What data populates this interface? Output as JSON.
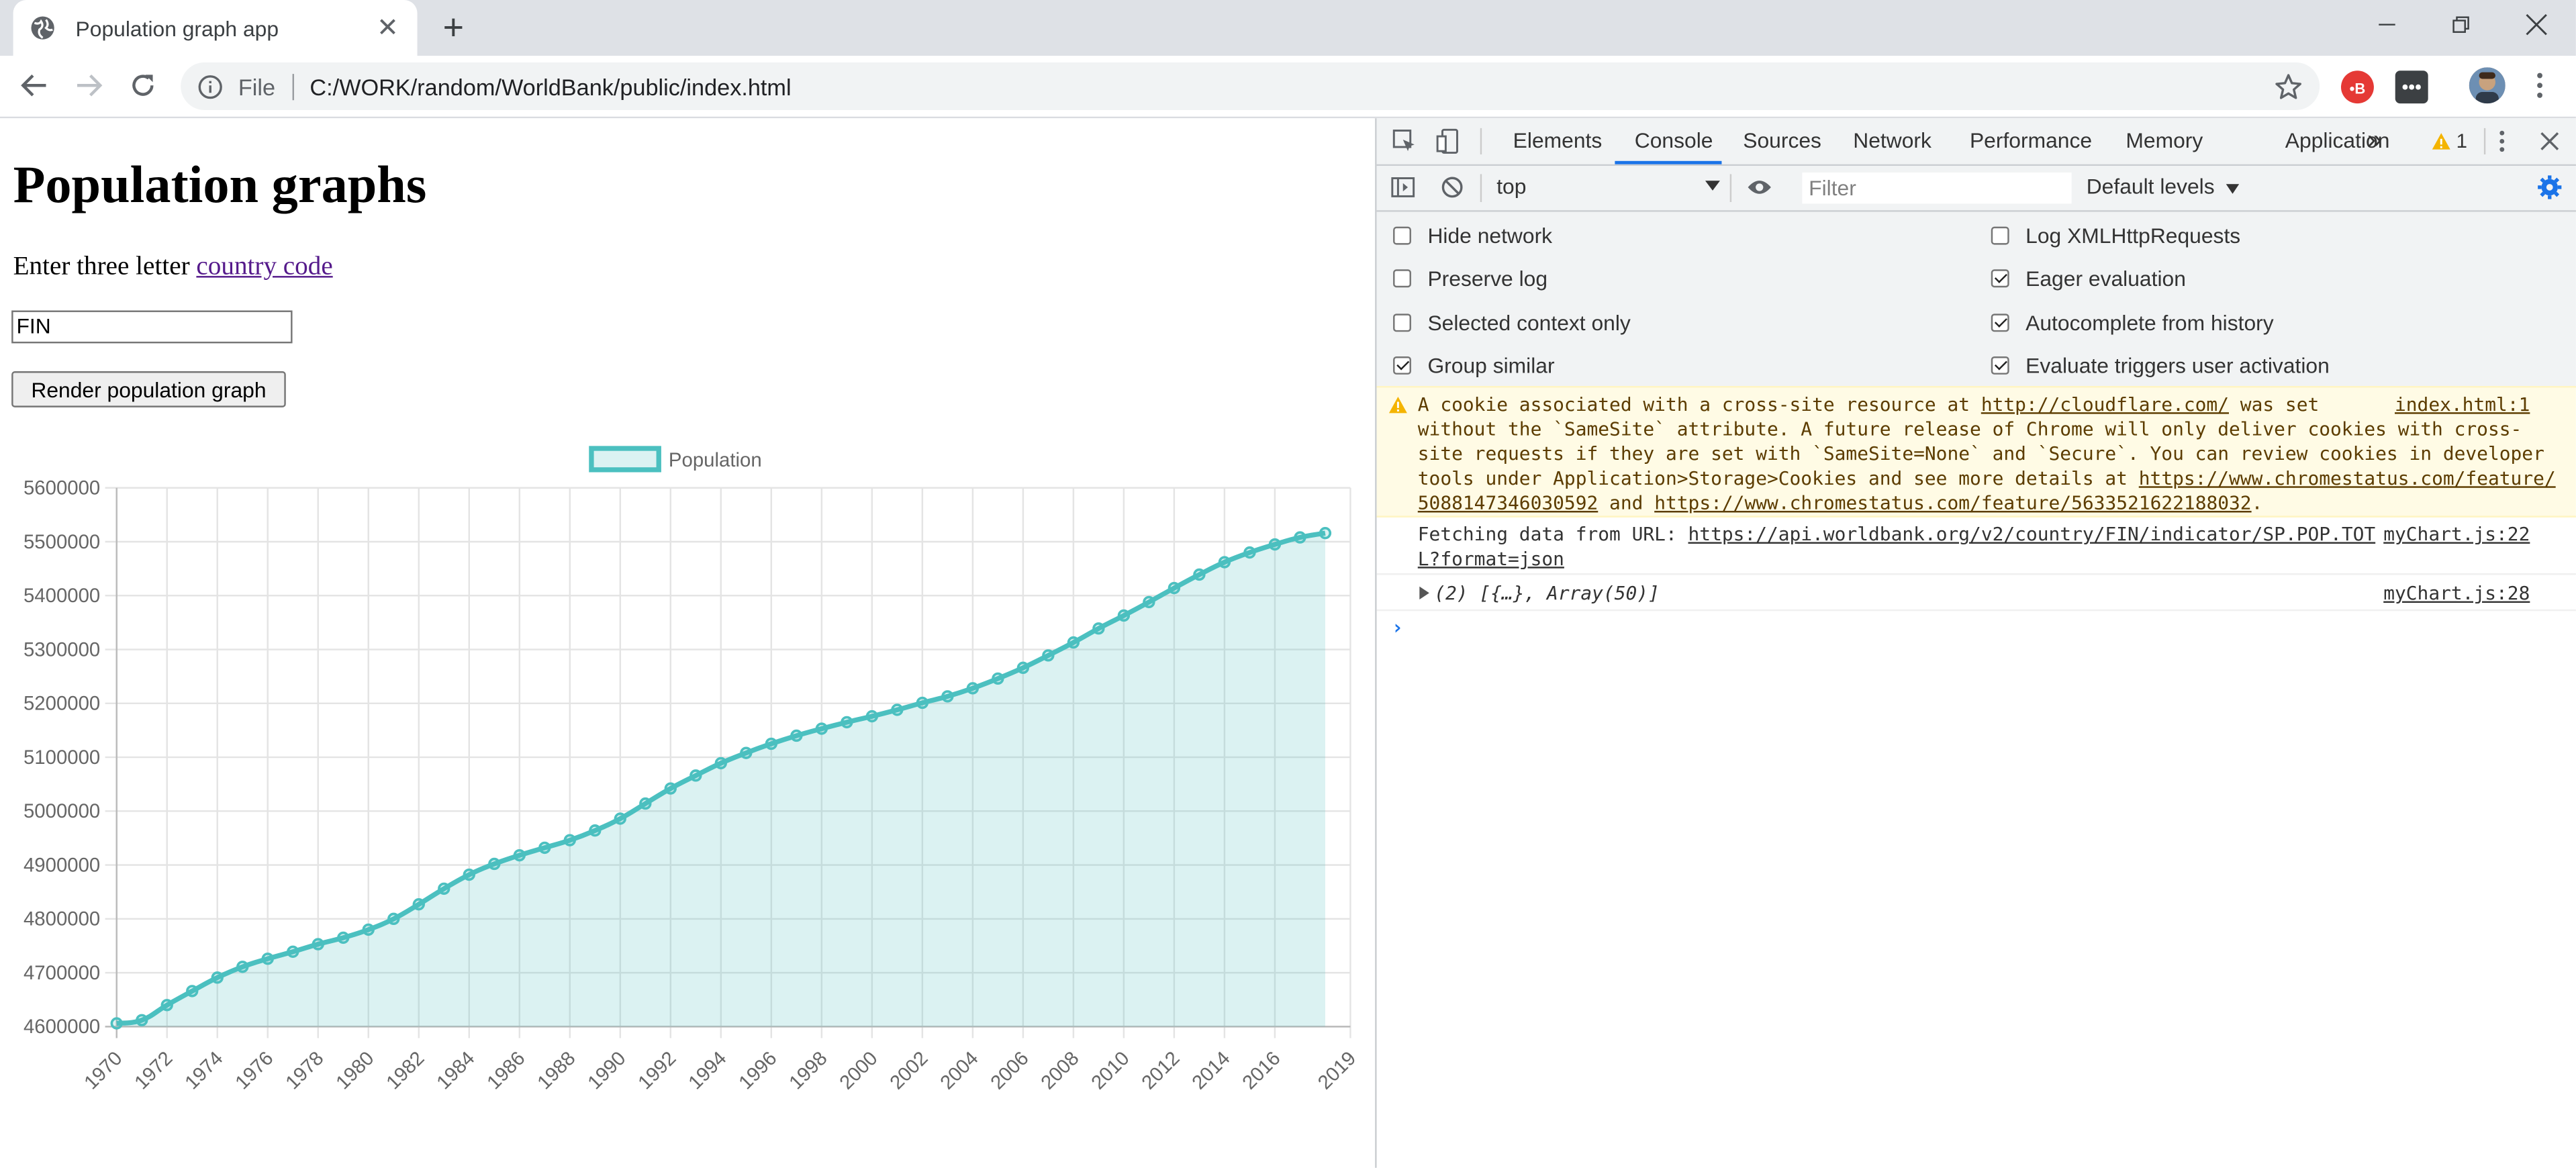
{
  "browser": {
    "tab_title": "Population graph app",
    "tab_close": "✕",
    "new_tab": "+",
    "url_scheme_label": "File",
    "url": "C:/WORK/random/WorldBank/public/index.html"
  },
  "page": {
    "heading": "Population graphs",
    "intro_text": "Enter three letter ",
    "intro_link": "country code",
    "country_input_value": "FIN",
    "render_button": "Render population graph"
  },
  "chart_data": {
    "type": "area",
    "legend": [
      "Population"
    ],
    "legend_position": "top",
    "series": [
      {
        "name": "Population",
        "color": "#4bc0c0",
        "fill": "rgba(75,192,192,0.2)",
        "x": [
          1970,
          1971,
          1972,
          1973,
          1974,
          1975,
          1976,
          1977,
          1978,
          1979,
          1980,
          1981,
          1982,
          1983,
          1984,
          1985,
          1986,
          1987,
          1988,
          1989,
          1990,
          1991,
          1992,
          1993,
          1994,
          1995,
          1996,
          1997,
          1998,
          1999,
          2000,
          2001,
          2002,
          2003,
          2004,
          2005,
          2006,
          2007,
          2008,
          2009,
          2010,
          2011,
          2012,
          2013,
          2014,
          2015,
          2016,
          2017,
          2018
        ],
        "values": [
          4606000,
          4612000,
          4640000,
          4666000,
          4691000,
          4711000,
          4726000,
          4739000,
          4753000,
          4765000,
          4780000,
          4800000,
          4827000,
          4856000,
          4882000,
          4902000,
          4918000,
          4932000,
          4946000,
          4964000,
          4986000,
          5014000,
          5042000,
          5066000,
          5089000,
          5108000,
          5125000,
          5140000,
          5153000,
          5165000,
          5176000,
          5188000,
          5201000,
          5213000,
          5228000,
          5246000,
          5266000,
          5289000,
          5313000,
          5339000,
          5363000,
          5388000,
          5414000,
          5439000,
          5462000,
          5480000,
          5495000,
          5508000,
          5516000
        ]
      }
    ],
    "x_tick_labels": [
      "1970",
      "1972",
      "1974",
      "1976",
      "1978",
      "1980",
      "1982",
      "1984",
      "1986",
      "1988",
      "1990",
      "1992",
      "1994",
      "1996",
      "1998",
      "2000",
      "2002",
      "2004",
      "2006",
      "2008",
      "2010",
      "2012",
      "2014",
      "2016",
      "2019"
    ],
    "y_tick_labels": [
      "5600000",
      "5500000",
      "5400000",
      "5300000",
      "5200000",
      "5100000",
      "5000000",
      "4900000",
      "4800000",
      "4700000",
      "4600000"
    ],
    "ylim": [
      4600000,
      5600000
    ],
    "grid": true
  },
  "devtools": {
    "tabs": [
      "Elements",
      "Console",
      "Sources",
      "Network",
      "Performance",
      "Memory",
      "Application"
    ],
    "active_tab": "Console",
    "more_tabs": "»",
    "warning_count": "1",
    "context": "top",
    "filter_placeholder": "Filter",
    "levels": "Default levels",
    "settings_left": [
      {
        "label": "Hide network",
        "checked": false
      },
      {
        "label": "Preserve log",
        "checked": false
      },
      {
        "label": "Selected context only",
        "checked": false
      },
      {
        "label": "Group similar",
        "checked": true
      }
    ],
    "settings_right": [
      {
        "label": "Log XMLHttpRequests",
        "checked": false
      },
      {
        "label": "Eager evaluation",
        "checked": true
      },
      {
        "label": "Autocomplete from history",
        "checked": true
      },
      {
        "label": "Evaluate triggers user activation",
        "checked": true
      }
    ],
    "warning": {
      "line1_pre": "A cookie associated with a cross-site resource at ",
      "line1_link": "http://cloudflare.com/",
      "line1_post": " was set",
      "line2": "without the `SameSite` attribute. A future release of Chrome will only deliver cookies with cross-",
      "line3": "site requests if they are set with `SameSite=None` and `Secure`. You can review cookies in developer",
      "line4_pre": "tools under Application>Storage>Cookies and see more details at ",
      "line4_link": "https://www.chromestatus.com/feature/",
      "line5_link1": "5088147346030592",
      "line5_mid": " and ",
      "line5_link2": "https://www.chromestatus.com/feature/5633521622188032",
      "line5_post": ".",
      "source": "index.html:1"
    },
    "log1": {
      "pre": "Fetching data from URL: ",
      "link1": "https://api.worldbank.org/v2/country/FIN/indicator/SP.POP.TOT",
      "link2": "L?format=json",
      "source": "myChart.js:22"
    },
    "log2": {
      "text": "(2) [{…}, Array(50)]",
      "source": "myChart.js:28"
    },
    "prompt": "›"
  }
}
